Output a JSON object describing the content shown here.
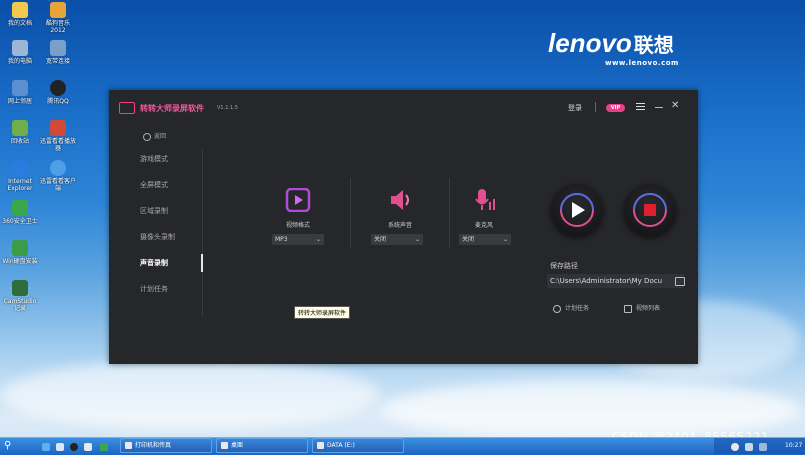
{
  "desktop": {
    "icons": [
      {
        "label": "我的文档",
        "color": "#f2c94c"
      },
      {
        "label": "酷狗音乐 2012",
        "color": "#e8a33a"
      },
      {
        "label": "我的电脑",
        "color": "#9db6d6"
      },
      {
        "label": "宽带连接",
        "color": "#7aa0c8"
      },
      {
        "label": "网上邻居",
        "color": "#5b8fd1"
      },
      {
        "label": "腾讯QQ",
        "color": "#222222"
      },
      {
        "label": "回收站",
        "color": "#6fae4b"
      },
      {
        "label": "迅雷看看播放器",
        "color": "#d04a3a"
      },
      {
        "label": "Internet Explorer",
        "color": "#2b7be0"
      },
      {
        "label": "迅雷看看客户端",
        "color": "#4f9ee8"
      },
      {
        "label": "360安全卫士",
        "color": "#3aa84a"
      },
      {
        "label": "Win硬盘安装",
        "color": "#3b9c48"
      },
      {
        "label": "CamStudio 记录",
        "color": "#2d6e3a"
      }
    ]
  },
  "lenovo": {
    "brand": "lenovo",
    "cn": "联想",
    "url": "www.lenovo.com"
  },
  "app": {
    "title": "转转大师录屏软件",
    "version": "V1.1.1.5",
    "login": "登录",
    "vip": "VIP",
    "back": "返回",
    "nav": [
      "游戏模式",
      "全屏模式",
      "区域录制",
      "摄像头录制",
      "声音录制",
      "计划任务"
    ],
    "active_nav": "声音录制",
    "sources": [
      {
        "label": "视频格式",
        "value": "MP3",
        "color": "#b04ad8"
      },
      {
        "label": "系统声音",
        "value": "关闭",
        "color": "#e0508e"
      },
      {
        "label": "麦克风",
        "value": "关闭",
        "color": "#e0508e"
      }
    ],
    "save_label": "保存路径",
    "save_path": "C:\\Users\\Administrator\\My Docu",
    "schedule_link": "计划任务",
    "video_list_link": "视频列表",
    "tooltip": "转转大师录屏软件"
  },
  "taskbar": {
    "windows": [
      "打印机和传真",
      "桌面",
      "DATA (E:)"
    ],
    "clock": "10:27"
  },
  "watermark": "CSDN @2401_85565221"
}
